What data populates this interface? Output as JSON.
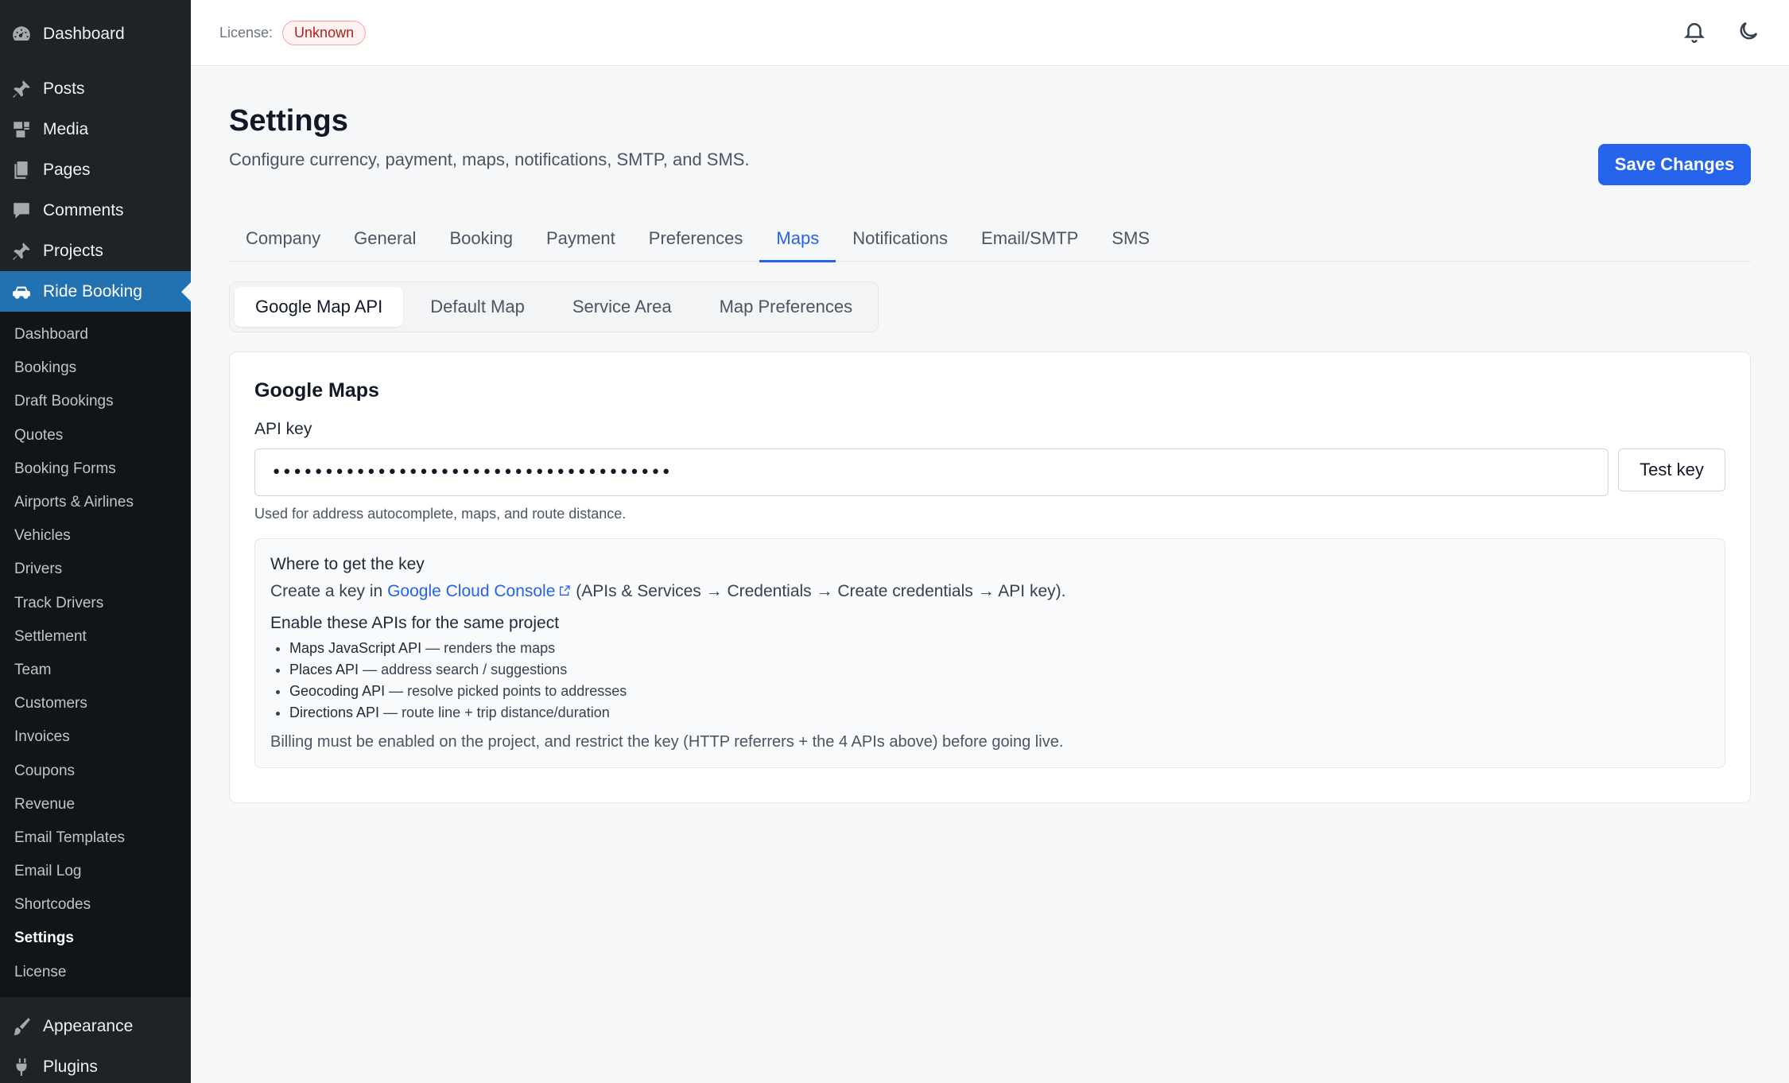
{
  "sidebar": {
    "top": [
      {
        "label": "Dashboard",
        "icon": "dashboard-icon"
      }
    ],
    "items": [
      {
        "label": "Posts",
        "icon": "pin-icon"
      },
      {
        "label": "Media",
        "icon": "media-icon"
      },
      {
        "label": "Pages",
        "icon": "pages-icon"
      },
      {
        "label": "Comments",
        "icon": "comment-icon"
      },
      {
        "label": "Projects",
        "icon": "pin-icon"
      },
      {
        "label": "Ride Booking",
        "icon": "car-icon"
      }
    ],
    "submenu": [
      "Dashboard",
      "Bookings",
      "Draft Bookings",
      "Quotes",
      "Booking Forms",
      "Airports & Airlines",
      "Vehicles",
      "Drivers",
      "Track Drivers",
      "Settlement",
      "Team",
      "Customers",
      "Invoices",
      "Coupons",
      "Revenue",
      "Email Templates",
      "Email Log",
      "Shortcodes",
      "Settings",
      "License"
    ],
    "bottom": [
      {
        "label": "Appearance",
        "icon": "brush-icon"
      },
      {
        "label": "Plugins",
        "icon": "plug-icon"
      }
    ]
  },
  "topbar": {
    "license_label": "License:",
    "license_status": "Unknown"
  },
  "page": {
    "title": "Settings",
    "subtitle": "Configure currency, payment, maps, notifications, SMTP, and SMS.",
    "save_label": "Save Changes"
  },
  "tabs": [
    "Company",
    "General",
    "Booking",
    "Payment",
    "Preferences",
    "Maps",
    "Notifications",
    "Email/SMTP",
    "SMS"
  ],
  "active_tab": "Maps",
  "subtabs": [
    "Google Map API",
    "Default Map",
    "Service Area",
    "Map Preferences"
  ],
  "active_subtab": "Google Map API",
  "card": {
    "title": "Google Maps",
    "api_key_label": "API key",
    "api_key_value": "••••••••••••••••••••••••••••••••••••••",
    "test_label": "Test key",
    "help": "Used for address autocomplete, maps, and route distance.",
    "info": {
      "heading": "Where to get the key",
      "line_prefix": "Create a key in",
      "link_text": "Google Cloud Console",
      "line_suffix": "(APIs & Services → Credentials → Create credentials → API key).",
      "apis_heading": "Enable these APIs for the same project",
      "apis": [
        {
          "name": "Maps JavaScript API",
          "desc": "— renders the maps"
        },
        {
          "name": "Places API",
          "desc": "— address search / suggestions"
        },
        {
          "name": "Geocoding API",
          "desc": "— resolve picked points to addresses"
        },
        {
          "name": "Directions API",
          "desc": "— route line + trip distance/duration"
        }
      ],
      "billing": "Billing must be enabled on the project, and restrict the key (HTTP referrers + the 4 APIs above) before going live."
    }
  },
  "colors": {
    "accent": "#2563eb",
    "sidebar_bg": "#1d2327",
    "sidebar_active": "#2271b1",
    "badge_text": "#b42318"
  }
}
